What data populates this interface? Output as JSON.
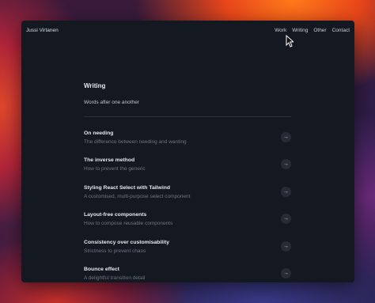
{
  "header": {
    "site_name": "Jussi Virtanen",
    "nav": [
      "Work",
      "Writing",
      "Other",
      "Contact"
    ]
  },
  "page": {
    "title": "Writing",
    "subtitle": "Words after one another"
  },
  "posts": [
    {
      "title": "On needing",
      "description": "The difference between needing and wanting"
    },
    {
      "title": "The inverse method",
      "description": "How to prevent the generic"
    },
    {
      "title": "Styling React Select with Tailwind",
      "description": "A customised, multi-purpose select component"
    },
    {
      "title": "Layout-free components",
      "description": "How to compose reusable components"
    },
    {
      "title": "Consistency over customisability",
      "description": "Strictness to prevent chaos"
    },
    {
      "title": "Bounce effect",
      "description": "A delightful transition detail"
    }
  ],
  "icons": {
    "post_arrow": "arrow-right-icon",
    "cursor": "mouse-pointer-icon"
  },
  "colors": {
    "window_bg": "#141821",
    "text_primary": "#e6e8ee",
    "text_muted": "#6f7582",
    "arrow_bg": "#262b36"
  }
}
